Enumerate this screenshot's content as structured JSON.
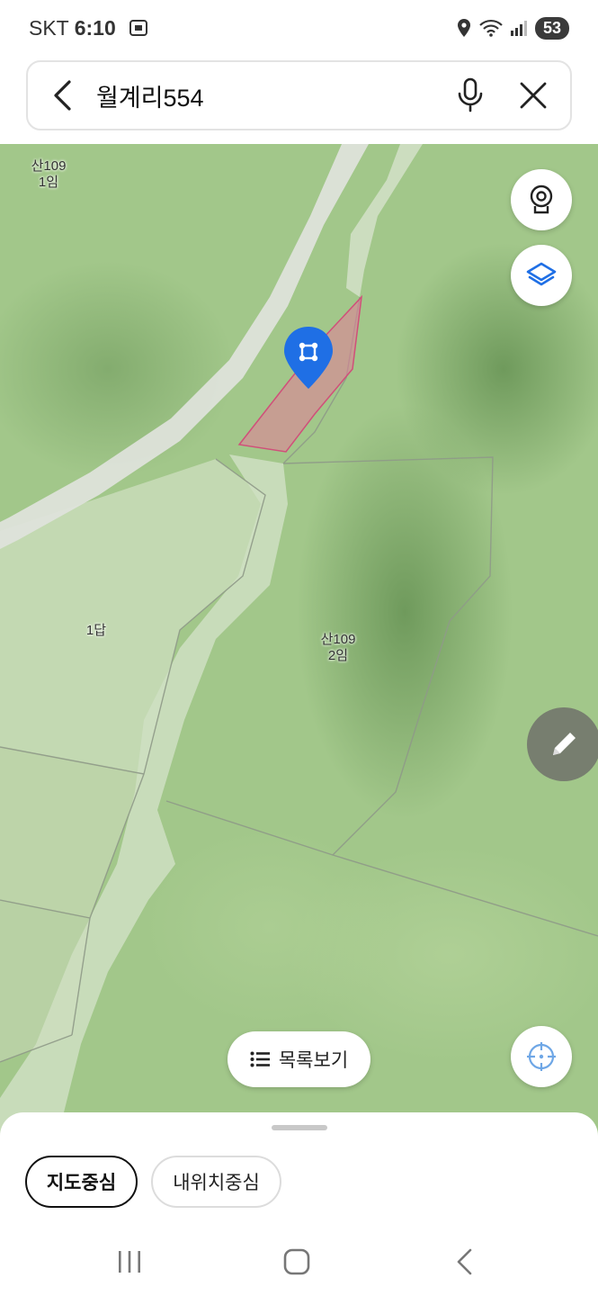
{
  "status": {
    "carrier": "SKT",
    "time": "6:10",
    "battery": "53"
  },
  "search": {
    "query": "월계리554"
  },
  "map": {
    "labels": [
      {
        "line1": "산109",
        "line2": "1임"
      },
      {
        "line1": "1답",
        "line2": ""
      },
      {
        "line1": "산109",
        "line2": "2임"
      }
    ],
    "highlight_color": "#e87a9a",
    "pin_color": "#1f6fe5"
  },
  "list_button": {
    "label": "목록보기"
  },
  "chips": {
    "map_center": "지도중심",
    "my_location_center": "내위치중심"
  }
}
